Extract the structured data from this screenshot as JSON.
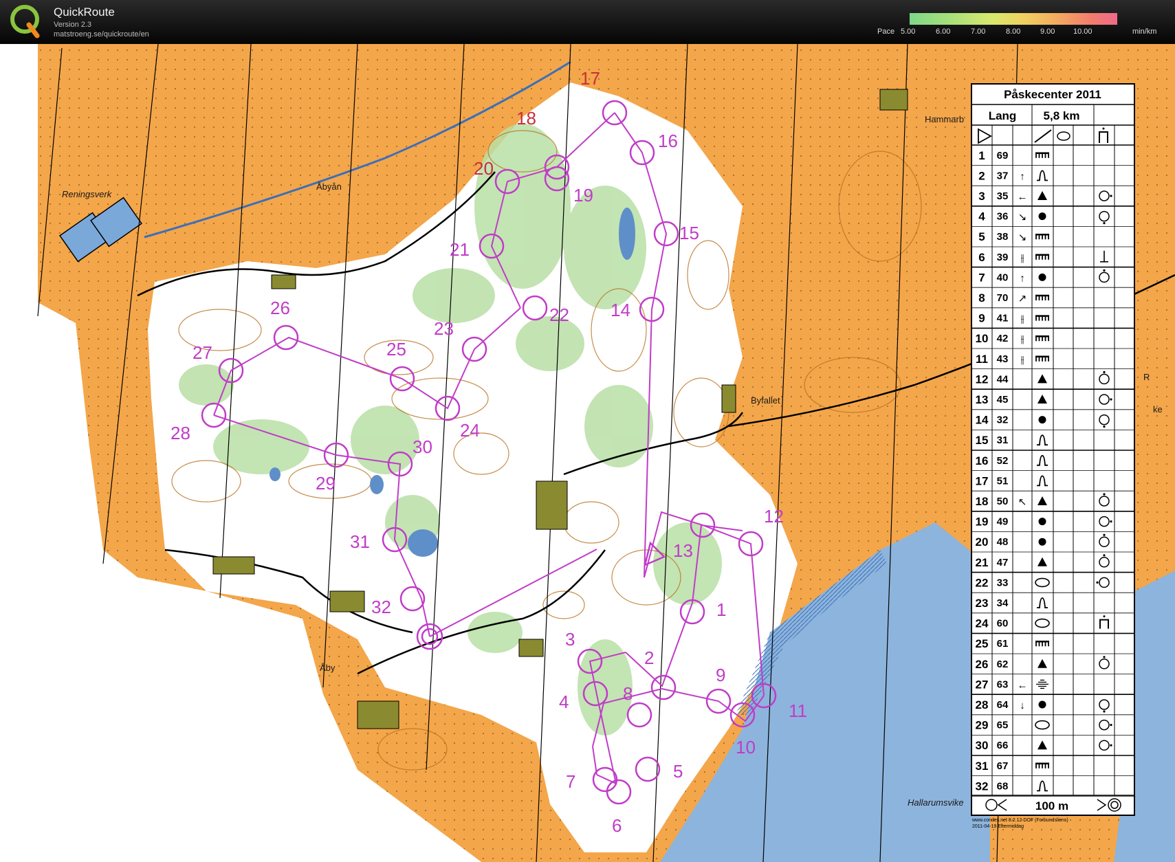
{
  "app": {
    "title": "QuickRoute",
    "version": "Version 2.3",
    "url": "matstroeng.se/quickroute/en",
    "logo_letter": "Q"
  },
  "pace_bar": {
    "label": "Pace",
    "ticks": [
      "5.00",
      "6.00",
      "7.00",
      "8.00",
      "9.00",
      "10.00"
    ],
    "unit": "min/km",
    "colors": [
      "#7fd88a",
      "#d9e86e",
      "#f2a860",
      "#f06a8a"
    ]
  },
  "map": {
    "colors": {
      "open_land": "#f4a64a",
      "forest": "#ffffff",
      "green": "#b9dfa6",
      "water": "#8db4dc",
      "course": "#c03cc8",
      "contour": "#b8701e"
    },
    "place_names": [
      "Reningsverk",
      "Åbyån",
      "Hammarb",
      "Byfallet",
      "Åby",
      "Hallarumsvike",
      "R",
      "ke"
    ],
    "controls": [
      "1",
      "2",
      "3",
      "4",
      "5",
      "6",
      "7",
      "8",
      "9",
      "10",
      "11",
      "12",
      "13",
      "14",
      "15",
      "16",
      "17",
      "18",
      "19",
      "20",
      "21",
      "22",
      "23",
      "24",
      "25",
      "26",
      "27",
      "28",
      "29",
      "30",
      "31",
      "32"
    ],
    "footer_note": [
      "www.condes.net 8.2.12 DOF (Forbundsliens)",
      "2011-04-19 Eftermiddag"
    ]
  },
  "control_descriptions": {
    "event": "Påskecenter 2011",
    "class": "Lang",
    "length": "5,8 km",
    "scale_text": "100 m",
    "rows": [
      {
        "n": "1",
        "code": "69",
        "dir": "",
        "feature": "cliff-icon",
        "extra": ""
      },
      {
        "n": "2",
        "code": "37",
        "dir": "↑",
        "feature": "gully-icon",
        "extra": ""
      },
      {
        "n": "3",
        "code": "35",
        "dir": "←",
        "feature": "boulder-triangle-icon",
        "extra": "side-circle-icon"
      },
      {
        "n": "4",
        "code": "36",
        "dir": "↘",
        "feature": "dot-icon",
        "extra": "bottom-circle-icon"
      },
      {
        "n": "5",
        "code": "38",
        "dir": "↘",
        "feature": "cliff-icon",
        "extra": ""
      },
      {
        "n": "6",
        "code": "39",
        "dir": "⫲",
        "feature": "cliff-icon",
        "extra": "foot-icon"
      },
      {
        "n": "7",
        "code": "40",
        "dir": "↑",
        "feature": "dot-icon",
        "extra": "top-circle-icon"
      },
      {
        "n": "8",
        "code": "70",
        "dir": "↗",
        "feature": "cliff-icon",
        "extra": ""
      },
      {
        "n": "9",
        "code": "41",
        "dir": "⫲",
        "feature": "cliff-icon",
        "extra": ""
      },
      {
        "n": "10",
        "code": "42",
        "dir": "⫲",
        "feature": "cliff-icon",
        "extra": ""
      },
      {
        "n": "11",
        "code": "43",
        "dir": "⫲",
        "feature": "cliff-icon",
        "extra": ""
      },
      {
        "n": "12",
        "code": "44",
        "dir": "",
        "feature": "boulder-triangle-icon",
        "extra": "top-circle-icon"
      },
      {
        "n": "13",
        "code": "45",
        "dir": "",
        "feature": "boulder-triangle-icon",
        "extra": "side-circle-icon"
      },
      {
        "n": "14",
        "code": "32",
        "dir": "",
        "feature": "dot-icon",
        "extra": "bottom-circle-icon"
      },
      {
        "n": "15",
        "code": "31",
        "dir": "",
        "feature": "gully-icon",
        "extra": ""
      },
      {
        "n": "16",
        "code": "52",
        "dir": "",
        "feature": "gully-icon",
        "extra": ""
      },
      {
        "n": "17",
        "code": "51",
        "dir": "",
        "feature": "gully-icon",
        "extra": ""
      },
      {
        "n": "18",
        "code": "50",
        "dir": "↖",
        "feature": "boulder-triangle-icon",
        "extra": "top-circle-icon"
      },
      {
        "n": "19",
        "code": "49",
        "dir": "",
        "feature": "dot-icon",
        "extra": "side-circle-icon"
      },
      {
        "n": "20",
        "code": "48",
        "dir": "",
        "feature": "dot-icon",
        "extra": "top-circle-icon"
      },
      {
        "n": "21",
        "code": "47",
        "dir": "",
        "feature": "boulder-triangle-icon",
        "extra": "top-circle-icon"
      },
      {
        "n": "22",
        "code": "33",
        "dir": "",
        "feature": "oval-icon",
        "extra": "left-circle-icon"
      },
      {
        "n": "23",
        "code": "34",
        "dir": "",
        "feature": "gully-icon",
        "extra": ""
      },
      {
        "n": "24",
        "code": "60",
        "dir": "",
        "feature": "oval-icon",
        "extra": "between-icon"
      },
      {
        "n": "25",
        "code": "61",
        "dir": "",
        "feature": "cliff-icon",
        "extra": ""
      },
      {
        "n": "26",
        "code": "62",
        "dir": "",
        "feature": "boulder-triangle-icon",
        "extra": "top-circle-icon"
      },
      {
        "n": "27",
        "code": "63",
        "dir": "←",
        "feature": "marsh-icon",
        "extra": ""
      },
      {
        "n": "28",
        "code": "64",
        "dir": "↓",
        "feature": "dot-icon",
        "extra": "bottom-circle-icon"
      },
      {
        "n": "29",
        "code": "65",
        "dir": "",
        "feature": "oval-icon",
        "extra": "side-circle-icon"
      },
      {
        "n": "30",
        "code": "66",
        "dir": "",
        "feature": "boulder-triangle-icon",
        "extra": "side-circle-icon"
      },
      {
        "n": "31",
        "code": "67",
        "dir": "",
        "feature": "cliff-icon",
        "extra": ""
      },
      {
        "n": "32",
        "code": "68",
        "dir": "",
        "feature": "gully-icon",
        "extra": ""
      }
    ]
  }
}
